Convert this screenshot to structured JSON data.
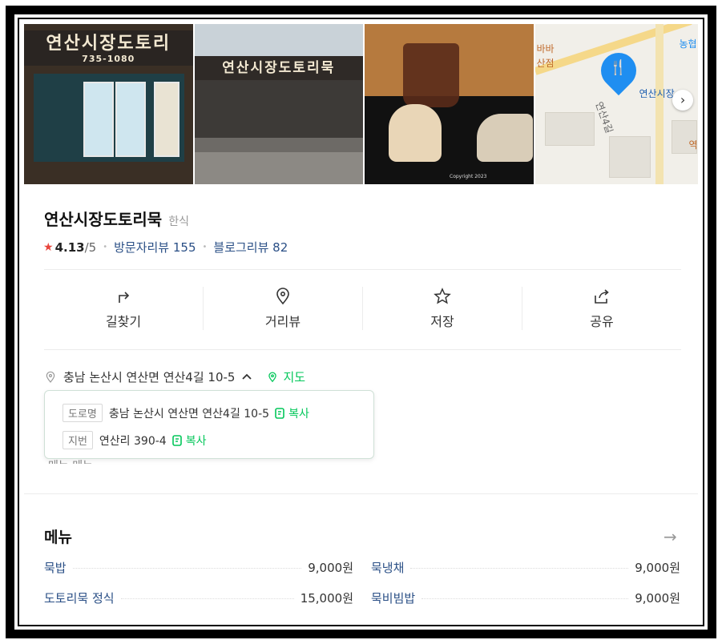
{
  "photos": {
    "sign_text": "연산시장도토리",
    "sign_phone": "735-1080",
    "sign2_text": "연산시장도토리묵",
    "photo3_watermark": "Copyright 2023",
    "map": {
      "labels": [
        "바바",
        "산점",
        "농협",
        "연산시장",
        "연산4길",
        "역"
      ]
    }
  },
  "place": {
    "name": "연산시장도토리묵",
    "category": "한식",
    "rating": "4.13",
    "rating_max": "/5",
    "visitor_reviews": "방문자리뷰 155",
    "blog_reviews": "블로그리뷰 82"
  },
  "actions": [
    {
      "label": "길찾기",
      "icon": "directions-icon"
    },
    {
      "label": "거리뷰",
      "icon": "streetview-pin-icon"
    },
    {
      "label": "저장",
      "icon": "star-outline-icon"
    },
    {
      "label": "공유",
      "icon": "share-icon"
    }
  ],
  "address": {
    "text": "충남 논산시 연산면 연산4길 10-5",
    "map_link": "지도",
    "road_tag": "도로명",
    "road_value": "충남 논산시 연산면 연산4길 10-5",
    "lot_tag": "지번",
    "lot_value": "연산리 390-4",
    "copy_label": "복사",
    "peek_text": "메뉴 메뉴"
  },
  "menu": {
    "title": "메뉴",
    "more": "→",
    "items": [
      {
        "name": "묵밥",
        "price": "9,000원"
      },
      {
        "name": "묵냉채",
        "price": "9,000원"
      },
      {
        "name": "도토리묵 정식",
        "price": "15,000원"
      },
      {
        "name": "묵비빔밥",
        "price": "9,000원"
      }
    ]
  },
  "colors": {
    "accent_green": "#03c75a",
    "link_blue": "#2a4f86",
    "star_red": "#e8453c",
    "map_pin": "#1f8ef1"
  }
}
